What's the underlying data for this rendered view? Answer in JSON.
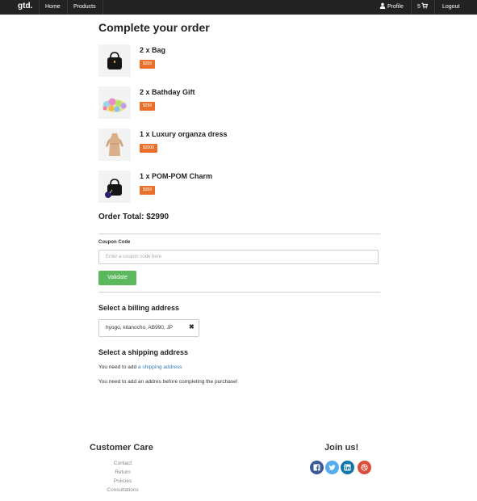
{
  "nav": {
    "brand": "gtd.",
    "home": "Home",
    "products": "Products",
    "profile": "Profile",
    "cart_count": "5",
    "logout": "Logout"
  },
  "page_title": "Complete your order",
  "items": [
    {
      "name": "2 x Bag",
      "price": "$200"
    },
    {
      "name": "2 x Bathday Gift",
      "price": "$290"
    },
    {
      "name": "1 x Luxury organza dress",
      "price": "$2000"
    },
    {
      "name": "1 x POM-POM Charm",
      "price": "$300"
    }
  ],
  "order_total": "Order Total: $2990",
  "coupon": {
    "label": "Coupon Code",
    "placeholder": "Enter a coupon code here",
    "button": "Validate"
  },
  "billing": {
    "heading": "Select a billing address",
    "address": "hyogo, kitanocho, AB990, JP",
    "remove_glyph": "✖"
  },
  "shipping": {
    "heading": "Select a shipping address",
    "need_prefix": "You need to add ",
    "need_link": "a shipping address",
    "warning": "You need to add an addres before completing the purchase!"
  },
  "footer": {
    "customer_care": "Customer Care",
    "links": [
      "Contact",
      "Return",
      "Policies",
      "Consultations"
    ],
    "join_us": "Join us!",
    "social": [
      {
        "icon": "facebook-icon",
        "color": "#3b5998"
      },
      {
        "icon": "twitter-icon",
        "color": "#55acee"
      },
      {
        "icon": "linkedin-icon",
        "color": "#0e76a8"
      },
      {
        "icon": "dribbble-icon",
        "color": "#dd4b39"
      }
    ]
  }
}
